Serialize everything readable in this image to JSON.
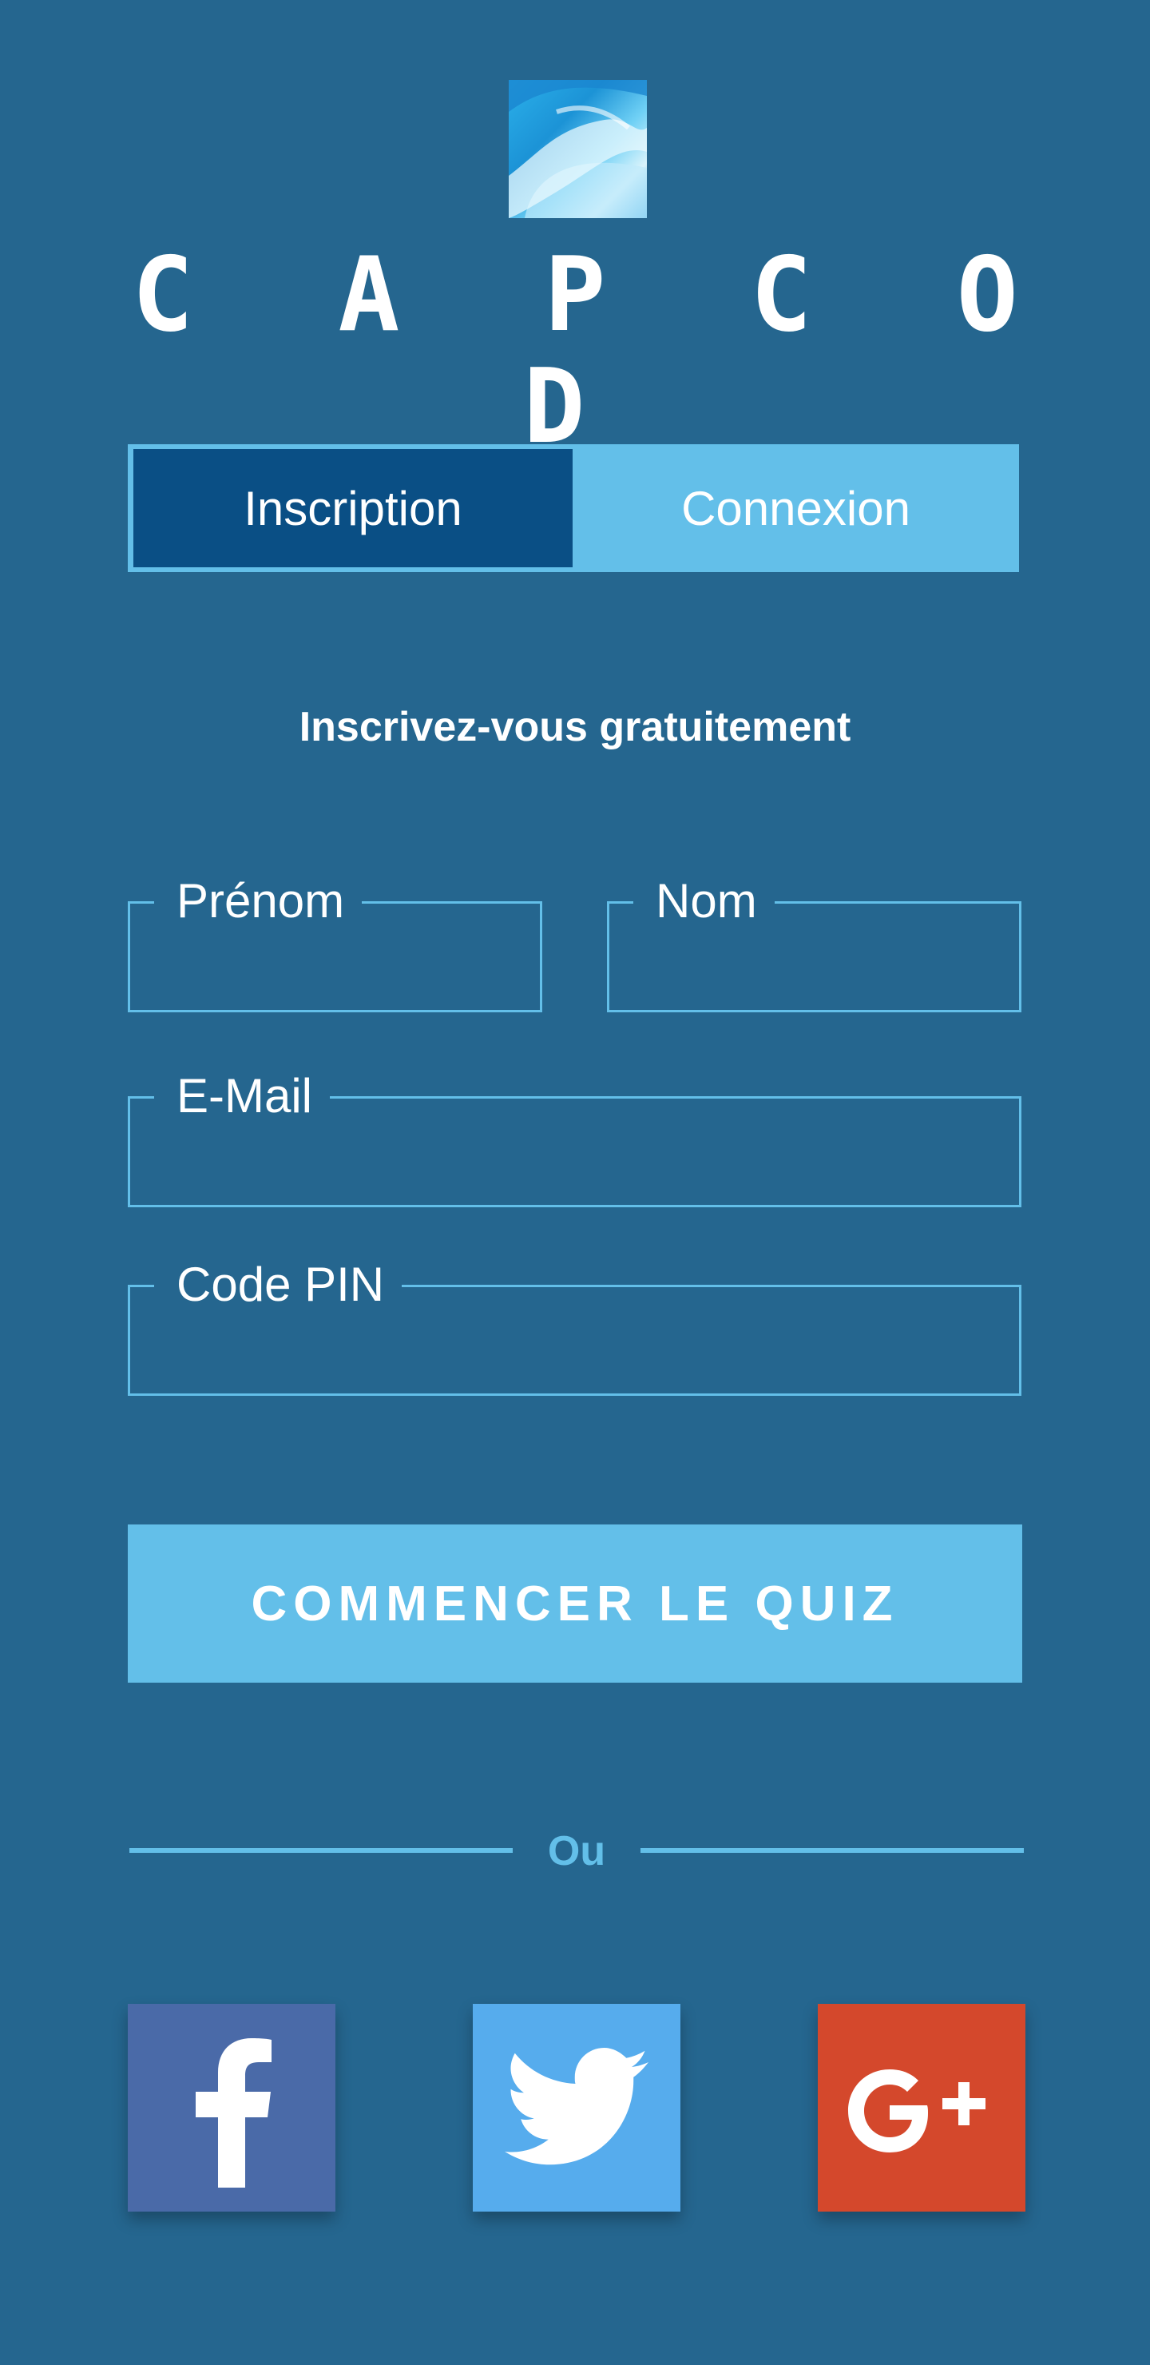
{
  "brand": {
    "name": "C A P C O D",
    "logo_icon": "capcod-logo-icon"
  },
  "tabs": [
    {
      "label": "Inscription",
      "active": true
    },
    {
      "label": "Connexion",
      "active": false
    }
  ],
  "form": {
    "subtitle": "Inscrivez-vous gratuitement",
    "first_name": {
      "label": "Prénom",
      "value": ""
    },
    "last_name": {
      "label": "Nom",
      "value": ""
    },
    "email": {
      "label": "E-Mail",
      "value": ""
    },
    "pin": {
      "label": "Code PIN",
      "value": ""
    },
    "submit_label": "COMMENCER LE QUIZ"
  },
  "separator": {
    "label": "Ou"
  },
  "social": [
    {
      "name": "facebook",
      "icon": "facebook-icon"
    },
    {
      "name": "twitter",
      "icon": "twitter-icon"
    },
    {
      "name": "google-plus",
      "icon": "google-plus-icon"
    }
  ],
  "colors": {
    "background": "#25668f",
    "accent": "#63bfe9",
    "tab_active": "#0a4f85",
    "facebook": "#4a6aa8",
    "twitter": "#56aced",
    "google_plus": "#d4482c"
  }
}
